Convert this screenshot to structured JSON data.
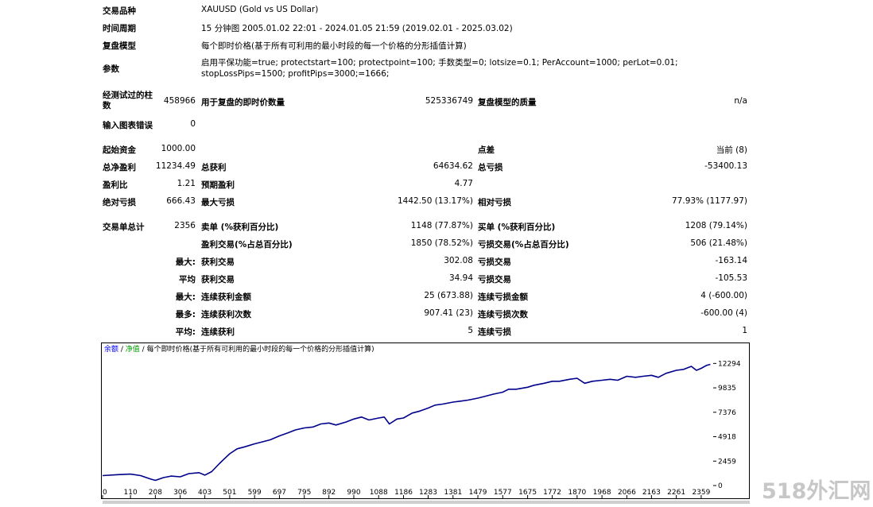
{
  "summary": {
    "symbol_label": "交易品种",
    "symbol_value": "XAUUSD (Gold vs US Dollar)",
    "period_label": "时间周期",
    "period_value": "15 分钟图 2005.01.02 22:01 - 2024.01.05 21:59 (2019.02.01 - 2025.03.02)",
    "model_label": "复盘模型",
    "model_value": "每个即时价格(基于所有可利用的最小时段的每一个价格的分形插值计算)",
    "params_label": "参数",
    "params_value": "启用平保功能=true; protectstart=100; protectpoint=100; 手数类型=0; lotsize=0.1; PerAccount=1000; perLot=0.01; stopLossPips=1500; profitPips=3000;=1666;"
  },
  "stats": {
    "bars_label": "经测试过的柱数",
    "bars_value": "458966",
    "ticks_label": "用于复盘的即时价数量",
    "ticks_value": "525336749",
    "quality_label": "复盘模型的质量",
    "quality_value": "n/a",
    "errors_label": "输入图表错误",
    "errors_value": "0",
    "initial_label": "起始资金",
    "initial_value": "1000.00",
    "spread_label": "点差",
    "spread_value": "当前 (8)",
    "net_label": "总净盈利",
    "net_value": "11234.49",
    "gross_profit_label": "总获利",
    "gross_profit_value": "64634.62",
    "gross_loss_label": "总亏损",
    "gross_loss_value": "-53400.13",
    "pf_label": "盈利比",
    "pf_value": "1.21",
    "expected_label": "预期盈利",
    "expected_value": "4.77",
    "abs_dd_label": "绝对亏损",
    "abs_dd_value": "666.43",
    "max_dd_label": "最大亏损",
    "max_dd_value": "1442.50 (13.17%)",
    "rel_dd_label": "相对亏损",
    "rel_dd_value": "77.93% (1177.97)",
    "total_trades_label": "交易单总计",
    "total_trades_value": "2356",
    "short_label": "卖单 (%获利百分比)",
    "short_value": "1148 (77.87%)",
    "long_label": "买单 (%获利百分比)",
    "long_value": "1208 (79.14%)",
    "profit_trades_label": "盈利交易(%占总百分比)",
    "profit_trades_value": "1850 (78.52%)",
    "loss_trades_label": "亏损交易(%占总百分比)",
    "loss_trades_value": "506 (21.48%)",
    "largest_label": "最大:",
    "largest_profit_label": "获利交易",
    "largest_profit_value": "302.08",
    "largest_loss_label": "亏损交易",
    "largest_loss_value": "-163.14",
    "average_label": "平均",
    "average_profit_label": "获利交易",
    "average_profit_value": "34.94",
    "average_loss_label": "亏损交易",
    "average_loss_value": "-105.53",
    "max_label": "最大:",
    "max_cons_wins_label": "连续获利金额",
    "max_cons_wins_value": "25 (673.88)",
    "max_cons_losses_label": "连续亏损金额",
    "max_cons_losses_value": "4 (-600.00)",
    "maximal_label": "最多:",
    "maximal_cons_profit_label": "连续获利次数",
    "maximal_cons_profit_value": "907.41 (23)",
    "maximal_cons_loss_label": "连续亏损次数",
    "maximal_cons_loss_value": "-600.00 (4)",
    "avg2_label": "平均:",
    "avg_cons_wins_label": "连续获利",
    "avg_cons_wins_value": "5",
    "avg_cons_losses_label": "连续亏损",
    "avg_cons_losses_value": "1"
  },
  "chart_data": {
    "type": "line",
    "title_balance": "余额",
    "title_sep1": " / ",
    "title_equity": "净值",
    "title_sep2": " / ",
    "title_rest": "每个即时价格(基于所有可利用的最小时段的每一个价格的分形插值计算)",
    "series_colors": {
      "balance": "#0000ff",
      "equity": "#00a000",
      "line": "#00008b"
    },
    "x_ticks": [
      0,
      110,
      208,
      306,
      403,
      501,
      599,
      697,
      795,
      892,
      990,
      1088,
      1186,
      1283,
      1381,
      1479,
      1577,
      1675,
      1772,
      1870,
      1968,
      2066,
      2163,
      2261,
      2359
    ],
    "y_ticks": [
      0,
      2459,
      4918,
      7376,
      9835,
      12294
    ],
    "xlim": [
      0,
      2400
    ],
    "ylim": [
      0,
      12800
    ],
    "series": [
      {
        "x": [
          0,
          60,
          110,
          150,
          190,
          208,
          240,
          270,
          306,
          340,
          380,
          403,
          430,
          460,
          480,
          501,
          530,
          560,
          599,
          630,
          660,
          697,
          730,
          760,
          795,
          830,
          860,
          892,
          920,
          960,
          990,
          1020,
          1050,
          1088,
          1110,
          1130,
          1160,
          1186,
          1220,
          1250,
          1283,
          1310,
          1340,
          1381,
          1410,
          1440,
          1479,
          1510,
          1540,
          1577,
          1600,
          1630,
          1675,
          1700,
          1740,
          1772,
          1800,
          1840,
          1870,
          1900,
          1930,
          1968,
          2000,
          2030,
          2066,
          2100,
          2130,
          2163,
          2190,
          2220,
          2261,
          2290,
          2320,
          2340,
          2359,
          2380,
          2395
        ],
        "values": [
          1000,
          1100,
          1150,
          1000,
          650,
          520,
          800,
          950,
          880,
          1200,
          1300,
          1050,
          1400,
          2200,
          2700,
          3200,
          3700,
          3900,
          4200,
          4400,
          4600,
          5000,
          5300,
          5600,
          5800,
          5900,
          6200,
          6300,
          6100,
          6400,
          6700,
          6900,
          6600,
          6800,
          6900,
          6200,
          6700,
          6800,
          7300,
          7500,
          7800,
          8100,
          8200,
          8400,
          8500,
          8600,
          8800,
          9000,
          9200,
          9400,
          9700,
          9700,
          9900,
          10100,
          10300,
          10500,
          10500,
          10700,
          10800,
          10300,
          10500,
          10600,
          10700,
          10600,
          11000,
          10900,
          11000,
          11100,
          10900,
          11300,
          11600,
          11700,
          12000,
          11600,
          11800,
          12100,
          12200
        ]
      }
    ]
  },
  "watermark": "518外汇网"
}
